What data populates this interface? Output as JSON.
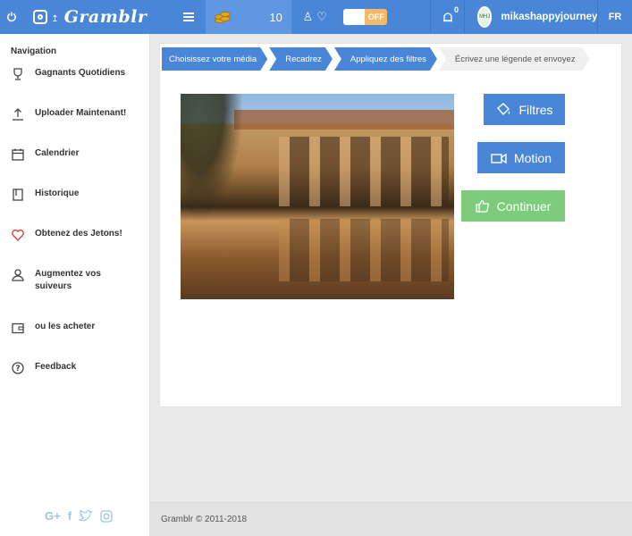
{
  "topbar": {
    "brand": "Gramblr",
    "coins": "10",
    "toggle_label": "OFF",
    "notifications_count": "0",
    "username": "mikashappyjourney",
    "language": "FR",
    "accent_color": "#4a86d8"
  },
  "sidebar": {
    "title": "Navigation",
    "items": [
      {
        "label": "Gagnants Quotidiens",
        "icon": "trophy-icon"
      },
      {
        "label": "Uploader Maintenant!",
        "icon": "upload-icon"
      },
      {
        "label": "Calendrier",
        "icon": "calendar-icon"
      },
      {
        "label": "Historique",
        "icon": "book-icon"
      },
      {
        "label": "Obtenez des Jetons!",
        "icon": "heart-icon"
      },
      {
        "label": "Augmentez vos suiveurs",
        "icon": "user-icon"
      },
      {
        "label": "ou les acheter",
        "icon": "wallet-icon"
      },
      {
        "label": "Feedback",
        "icon": "help-icon"
      }
    ],
    "social": [
      "google-plus-icon",
      "facebook-icon",
      "twitter-icon",
      "instagram-icon"
    ]
  },
  "steps": [
    {
      "label": "Choisissez votre média",
      "active": true
    },
    {
      "label": "Recadrez",
      "active": true
    },
    {
      "label": "Appliquez des filtres",
      "active": true
    },
    {
      "label": "Écrivez une légende et envoyez",
      "active": false
    }
  ],
  "actions": {
    "filtres": "Filtres",
    "motion": "Motion",
    "continuer": "Continuer"
  },
  "footer": {
    "copyright": "Gramblr © 2011-2018"
  }
}
